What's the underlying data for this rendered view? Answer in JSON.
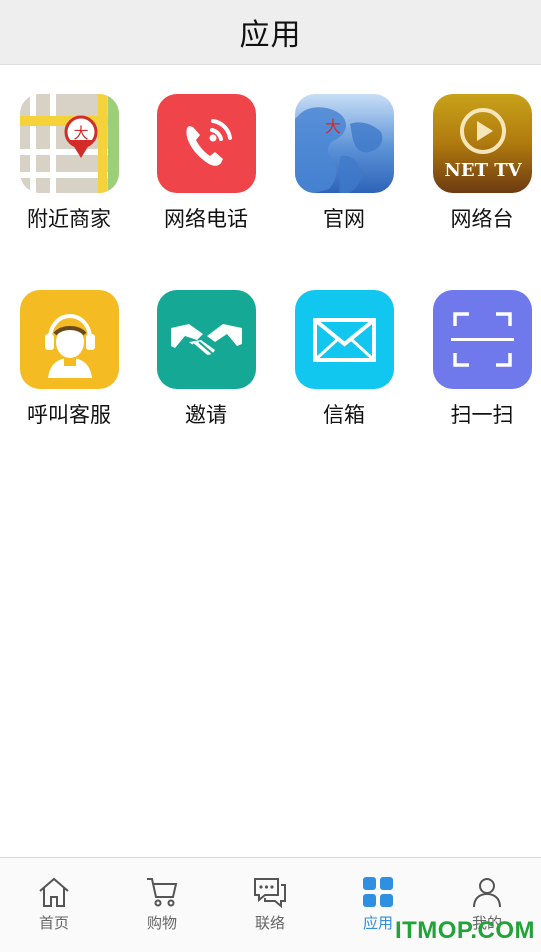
{
  "header": {
    "title": "应用"
  },
  "apps": [
    {
      "label": "附近商家",
      "icon": "map-pin-icon"
    },
    {
      "label": "网络电话",
      "icon": "phone-call-icon"
    },
    {
      "label": "官网",
      "icon": "globe-icon"
    },
    {
      "label": "网络台",
      "icon": "net-tv-icon",
      "badge_text": "NET TV"
    },
    {
      "label": "呼叫客服",
      "icon": "headset-agent-icon"
    },
    {
      "label": "邀请",
      "icon": "handshake-icon"
    },
    {
      "label": "信箱",
      "icon": "envelope-icon"
    },
    {
      "label": "扫一扫",
      "icon": "scan-icon"
    }
  ],
  "tabbar": {
    "items": [
      {
        "label": "首页",
        "icon": "home-icon"
      },
      {
        "label": "购物",
        "icon": "cart-icon"
      },
      {
        "label": "联络",
        "icon": "chat-icon"
      },
      {
        "label": "应用",
        "icon": "apps-grid-icon",
        "active": true
      },
      {
        "label": "我的",
        "icon": "user-icon"
      }
    ]
  },
  "colors": {
    "accent": "#2f8fe0",
    "header_bg": "#eeeeee",
    "tab_inactive": "#666666"
  },
  "watermark": "ITMOP.COM"
}
